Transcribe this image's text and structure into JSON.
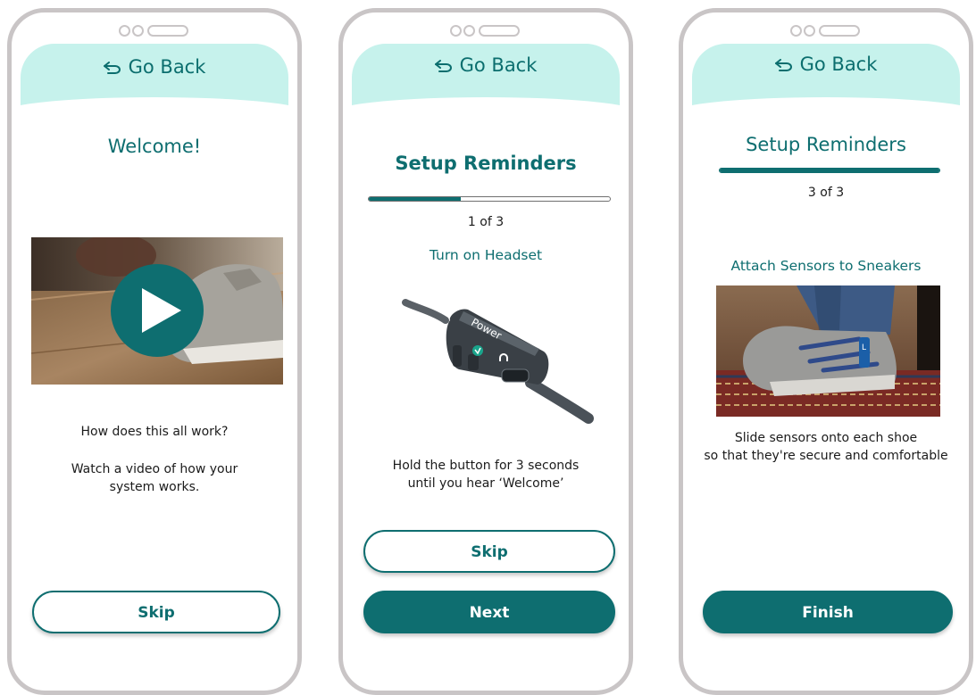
{
  "screens": [
    {
      "back_label": "Go Back",
      "title": "Welcome!",
      "question": "How does this all work?",
      "description": "Watch a video of how your system works.",
      "skip_label": "Skip"
    },
    {
      "back_label": "Go Back",
      "title": "Setup Reminders",
      "progress": {
        "current": 1,
        "total": 3,
        "fraction": 0.38
      },
      "step_label": "1 of 3",
      "step_title": "Turn on Headset",
      "device_label": "Power",
      "instruction": "Hold the button for 3 seconds until you hear ‘Welcome’",
      "skip_label": "Skip",
      "next_label": "Next"
    },
    {
      "back_label": "Go Back",
      "title": "Setup Reminders",
      "progress": {
        "current": 3,
        "total": 3,
        "fraction": 1.0
      },
      "step_label": "3 of 3",
      "step_title": "Attach Sensors to Sneakers",
      "instruction_line1": "Slide sensors onto each shoe",
      "instruction_line2": "so that they're secure and comfortable",
      "finish_label": "Finish"
    }
  ],
  "colors": {
    "accent": "#0e6e70",
    "header_bg": "#c6f2ec",
    "frame": "#c9c5c6"
  }
}
